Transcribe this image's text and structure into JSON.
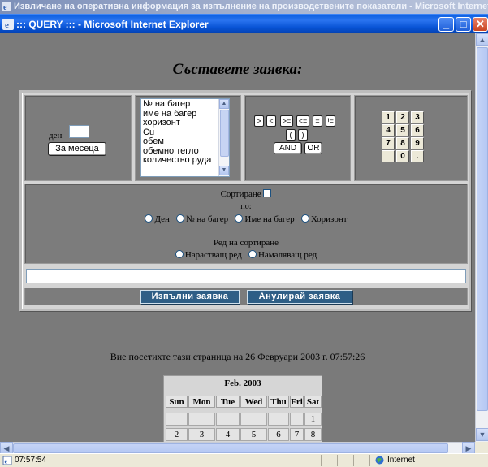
{
  "parent_window": {
    "title": "Извличане на оперативна информация за изпълнение на производствените показатели - Microsoft Internet Explorer"
  },
  "ie_window": {
    "title": "::: QUERY ::: - Microsoft Internet Explorer"
  },
  "page": {
    "heading": "Съставете заявка:",
    "day_label": "ден",
    "day_value": "",
    "month_button": "За месеца",
    "fields": [
      "№ на багер",
      "име на багер",
      "хоризонт",
      "Cu",
      "обем",
      "обемно тегло",
      "количество руда"
    ],
    "operators_row1": [
      ">",
      "<",
      ">=",
      "<=",
      "=",
      "!="
    ],
    "operators_row2": [
      "(",
      ")"
    ],
    "logic_buttons": [
      "AND",
      "OR"
    ],
    "keypad": [
      "1",
      "2",
      "3",
      "4",
      "5",
      "6",
      "7",
      "8",
      "9",
      "",
      "0",
      "."
    ],
    "sort_label": "Сортиране",
    "sort_by_label": "по:",
    "sort_options": [
      "Ден",
      "№ на багер",
      "Име на багер",
      "Хоризонт"
    ],
    "order_label": "Ред на сортиране",
    "order_options": [
      "Нарастващ ред",
      "Намаляващ ред"
    ],
    "query_text": "",
    "execute_button": "Изпълни заявка",
    "cancel_button": "Анулирай заявка",
    "visit_text": "Вие посетихте тази страница на 26 Февруари 2003 г. 07:57:26"
  },
  "calendar": {
    "month": "Feb. 2003",
    "weekdays": [
      "Sun",
      "Mon",
      "Tue",
      "Wed",
      "Thu",
      "Fri",
      "Sat"
    ],
    "row1": [
      "",
      "",
      "",
      "",
      "",
      "",
      "1"
    ],
    "row2": [
      "2",
      "3",
      "4",
      "5",
      "6",
      "7",
      "8"
    ]
  },
  "statusbar": {
    "time": "07:57:54",
    "zone": "Internet"
  },
  "colors": {
    "title_blue": "#0752d4",
    "submit_bg": "#2e5e86",
    "page_bg": "#7a7a7a"
  }
}
